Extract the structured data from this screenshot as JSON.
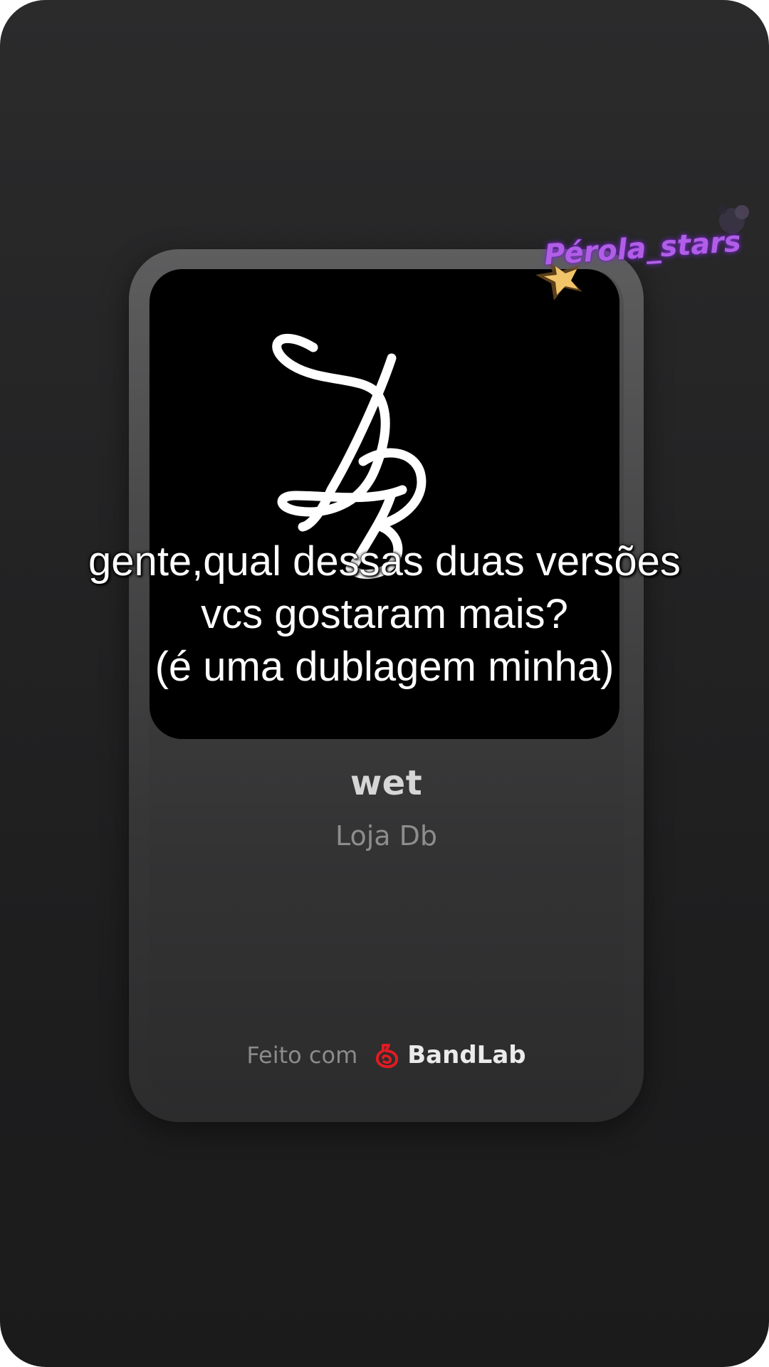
{
  "caption": {
    "line1": "gente,qual dessas duas versões",
    "line2": "vcs gostaram mais?",
    "line3": "(é uma dublagem minha)"
  },
  "track": {
    "title": "wet",
    "artist": "Loja Db",
    "artwork_icon": "db-monogram-icon"
  },
  "footer": {
    "made_with": "Feito com",
    "brand": "BandLab",
    "brand_icon": "bandlab-logo-icon",
    "brand_color": "#e11b22"
  },
  "sticker": {
    "text": "Pérola_stars",
    "color": "#b15ee6",
    "icon": "star-sticker-icon"
  },
  "colors": {
    "background": "#232324",
    "card": "#4a4a4b",
    "artwork_bg": "#000000"
  }
}
